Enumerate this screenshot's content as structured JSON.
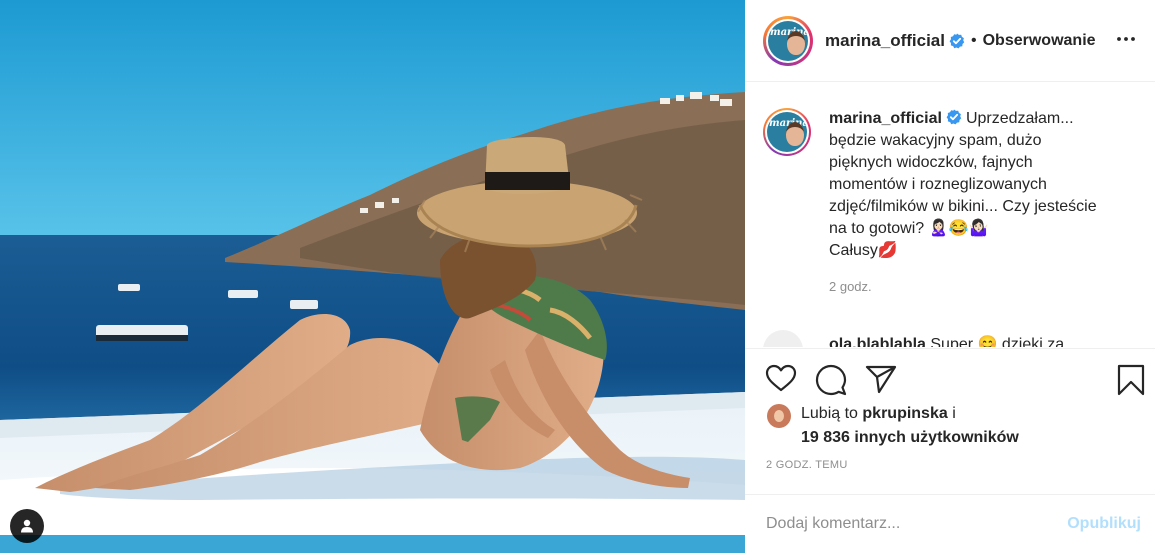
{
  "post": {
    "username": "marina_official",
    "follow_separator": "•",
    "follow_label": "Obserwowanie",
    "avatar_logo": "marina",
    "caption_lines": [
      "Uprzedzałam...",
      "będzie wakacyjny spam, dużo",
      "pięknych widoczków, fajnych",
      "momentów i rozneglizowanych",
      "zdjęć/filmików w bikini... Czy jesteście",
      "na to gotowi? 🙎🏻‍♀️😂🤷🏻‍♀️",
      "Całusy💋"
    ],
    "caption_time": "2 godz.",
    "second_comment_user": "ola.blablabla",
    "second_comment_text": "Super 😊 dzięki za",
    "likes_prefix": "Lubią to ",
    "likes_user": "pkrupinska",
    "likes_and": " i",
    "likes_count_text": "19 836 innych użytkowników",
    "timestamp": "2 GODZ. TEMU",
    "comment_placeholder": "Dodaj komentarz...",
    "publish_label": "Opublikuj"
  },
  "icons": {
    "verified": "verified-badge-icon",
    "more": "more-options-icon",
    "like": "heart-icon",
    "comment": "comment-bubble-icon",
    "share": "paper-plane-icon",
    "save": "bookmark-icon",
    "tag": "user-tag-icon"
  },
  "colors": {
    "verified_blue": "#3897f0",
    "publish_disabled": "#b2dffc",
    "muted_text": "#8e8e8e",
    "divider": "#efefef"
  }
}
